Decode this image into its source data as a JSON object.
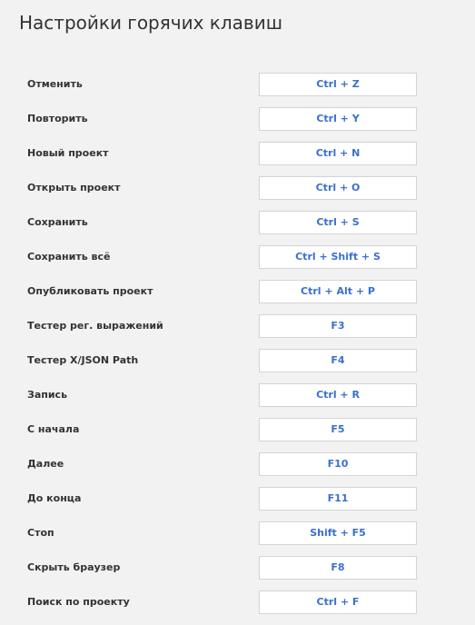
{
  "title": "Настройки горячих клавиш",
  "colors": {
    "background": "#f2f2f2",
    "shortcut_text": "#3b6fcf",
    "label_text": "#333333",
    "field_border": "#d4d4d4"
  },
  "shortcuts": [
    {
      "label": "Отменить",
      "key": "Ctrl + Z"
    },
    {
      "label": "Повторить",
      "key": "Ctrl + Y"
    },
    {
      "label": "Новый проект",
      "key": "Ctrl + N"
    },
    {
      "label": "Открыть проект",
      "key": "Ctrl + O"
    },
    {
      "label": "Сохранить",
      "key": "Ctrl + S"
    },
    {
      "label": "Сохранить всё",
      "key": "Ctrl + Shift + S"
    },
    {
      "label": "Опубликовать проект",
      "key": "Ctrl + Alt + P"
    },
    {
      "label": "Тестер рег. выражений",
      "key": "F3"
    },
    {
      "label": "Тестер X/JSON Path",
      "key": "F4"
    },
    {
      "label": "Запись",
      "key": "Ctrl + R"
    },
    {
      "label": "С начала",
      "key": "F5"
    },
    {
      "label": "Далее",
      "key": "F10"
    },
    {
      "label": "До конца",
      "key": "F11"
    },
    {
      "label": "Стоп",
      "key": "Shift + F5"
    },
    {
      "label": "Скрыть браузер",
      "key": "F8"
    },
    {
      "label": "Поиск по проекту",
      "key": "Ctrl + F"
    }
  ]
}
